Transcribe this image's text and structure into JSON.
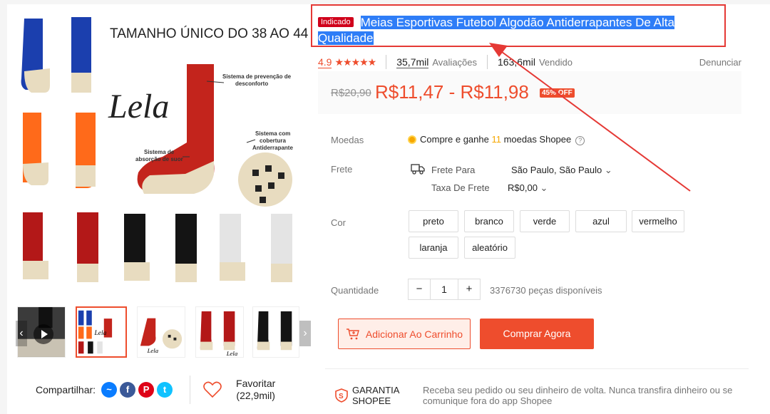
{
  "gallery": {
    "main_image_text": {
      "headline": "TAMANHO ÚNICO DO 38 AO 44",
      "brand": "Lela",
      "callout_1": "Sistema de prevenção de desconforto",
      "callout_2": "Sistema com cobertura Antiderrapante",
      "callout_3": "Sistema de absorção de suor"
    },
    "thumbnails": [
      "video",
      "size-chart",
      "features",
      "red",
      "black-white"
    ]
  },
  "share": {
    "label": "Compartilhar:",
    "networks": [
      "messenger",
      "facebook",
      "pinterest",
      "twitter"
    ],
    "favorite_label": "Favoritar",
    "favorite_count": "(22,9mil)"
  },
  "product": {
    "badge": "Indicado",
    "title": "Meias Esportivas Futebol Algodão Antiderrapantes De Alta Qualidade",
    "rating": "4.9",
    "stars": "★★★★★",
    "reviews_count": "35,7mil",
    "reviews_label": "Avaliações",
    "sold_count": "163,6mil",
    "sold_label": "Vendido",
    "report": "Denunciar",
    "old_price": "R$20,90",
    "price": "R$11,47 - R$11,98",
    "discount": "45% OFF"
  },
  "rows": {
    "coins_label": "Moedas",
    "coins_pre": "Compre e ganhe ",
    "coins_num": "11",
    "coins_post": " moedas Shopee",
    "shipping_label": "Frete",
    "ship_to_label": "Frete Para",
    "ship_to_value": "São Paulo, São Paulo",
    "ship_fee_label": "Taxa De Frete",
    "ship_fee_value": "R$0,00",
    "color_label": "Cor",
    "colors": [
      "preto",
      "branco",
      "verde",
      "azul",
      "vermelho",
      "laranja",
      "aleatório"
    ],
    "qty_label": "Quantidade",
    "qty_value": "1",
    "stock": "3376730 peças disponíveis"
  },
  "actions": {
    "add_to_cart": "Adicionar Ao Carrinho",
    "buy_now": "Comprar Agora"
  },
  "guarantee": {
    "title_line1": "GARANTIA",
    "title_line2": "SHOPEE",
    "description": "Receba seu pedido ou seu dinheiro de volta. Nunca transfira dinheiro ou se comunique fora do app Shopee"
  },
  "colors": {
    "brand": "#ee4d2d",
    "annotation": "#e53935",
    "highlight": "#2e7df7"
  }
}
